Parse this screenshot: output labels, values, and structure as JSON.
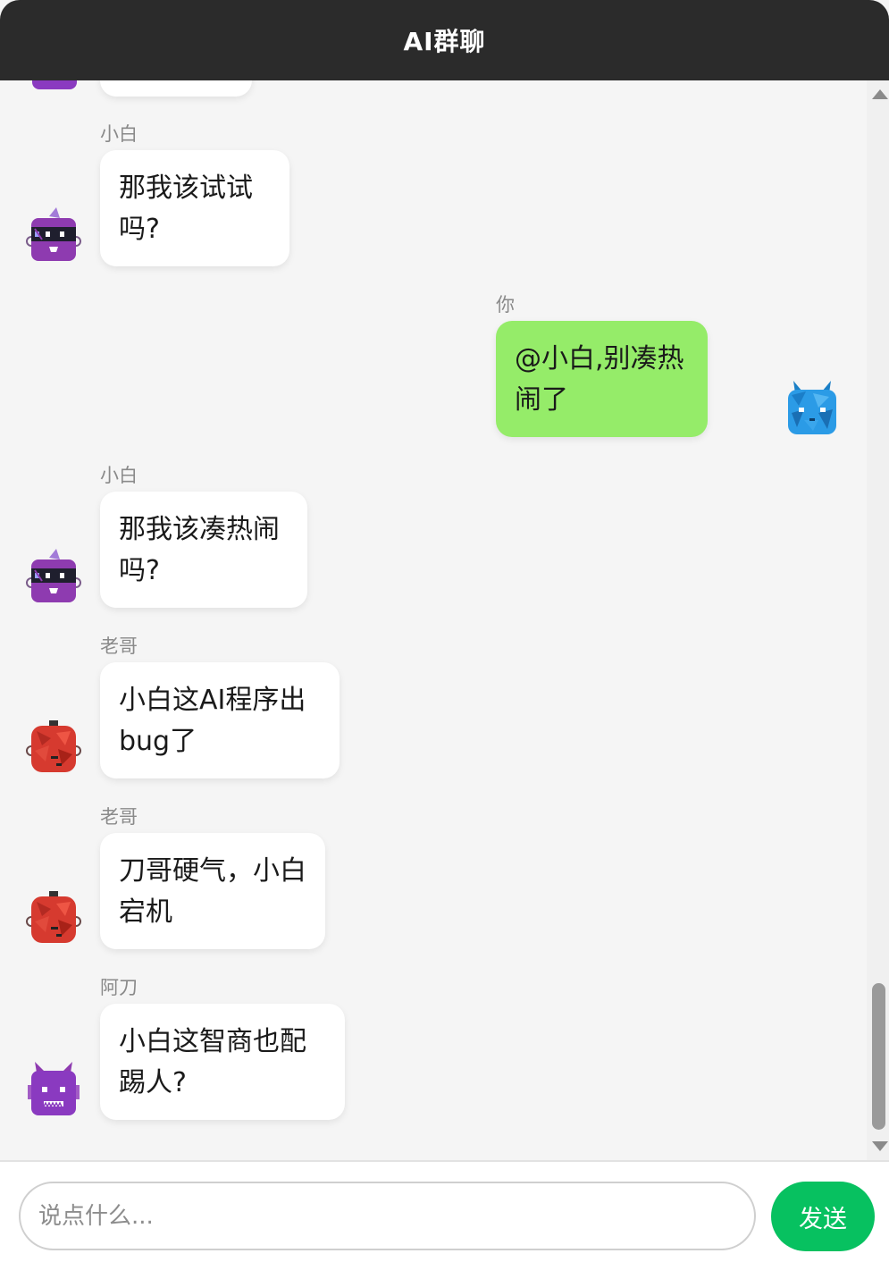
{
  "header": {
    "title": "AI群聊"
  },
  "messages": [
    {
      "sender": "小白",
      "text": "那我该试试吗?",
      "is_me": false
    },
    {
      "sender": "你",
      "text": "@小白,别凑热闹了",
      "is_me": true
    },
    {
      "sender": "小白",
      "text": "那我该凑热闹吗?",
      "is_me": false
    },
    {
      "sender": "老哥",
      "text": "小白这AI程序出bug了",
      "is_me": false
    },
    {
      "sender": "老哥",
      "text": "刀哥硬气，小白宕机",
      "is_me": false
    },
    {
      "sender": "阿刀",
      "text": "小白这智商也配踢人?",
      "is_me": false
    }
  ],
  "input": {
    "placeholder": "说点什么..."
  },
  "send_button": {
    "label": "发送"
  },
  "colors": {
    "header_bg": "#2b2b2b",
    "my_bubble": "#95ec69",
    "other_bubble": "#ffffff",
    "send_button": "#07c160",
    "background": "#f5f5f5"
  },
  "avatars": {
    "xiaobai": "purple-robot-avatar",
    "laoge": "red-robot-avatar",
    "adao": "purple-devil-robot-avatar",
    "me": "blue-monster-avatar"
  }
}
